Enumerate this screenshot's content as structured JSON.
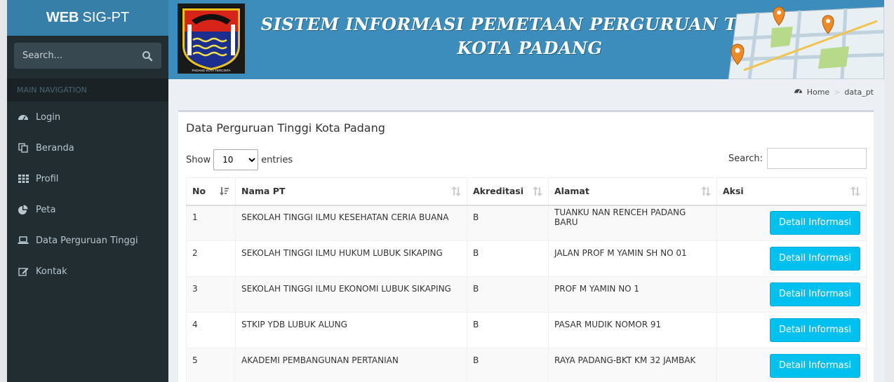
{
  "sidebar": {
    "logo_bold": "WEB",
    "logo_rest": "SIG-PT",
    "search_placeholder": "Search...",
    "nav_header": "MAIN NAVIGATION",
    "items": [
      {
        "label": "Login",
        "icon": "dashboard-icon"
      },
      {
        "label": "Beranda",
        "icon": "files-icon"
      },
      {
        "label": "Profil",
        "icon": "grid-icon"
      },
      {
        "label": "Peta",
        "icon": "pie-chart-icon"
      },
      {
        "label": "Data Perguruan Tinggi",
        "icon": "laptop-icon"
      },
      {
        "label": "Kontak",
        "icon": "edit-icon"
      }
    ]
  },
  "header": {
    "title_line1": "SISTEM INFORMASI PEMETAAN PERGURUAN TINGGI",
    "title_line2": "KOTA PADANG",
    "emblem_text": "PADANG KOTA TERCINTA"
  },
  "breadcrumb": {
    "home": "Home",
    "current": "data_pt"
  },
  "box": {
    "title": "Data Perguruan Tinggi Kota Padang",
    "show_label": "Show",
    "entries_label": "entries",
    "length_value": "10",
    "search_label": "Search:"
  },
  "table": {
    "headers": [
      "No",
      "Nama PT",
      "Akreditasi",
      "Alamat",
      "Aksi"
    ],
    "button_label": "Detail Informasi",
    "rows": [
      {
        "no": "1",
        "nama": "SEKOLAH TINGGI ILMU KESEHATAN CERIA BUANA",
        "akreditasi": "B",
        "alamat": "TUANKU NAN RENCEH PADANG BARU"
      },
      {
        "no": "2",
        "nama": "SEKOLAH TINGGI ILMU HUKUM LUBUK SIKAPING",
        "akreditasi": "B",
        "alamat": "JALAN PROF M YAMIN SH NO 01"
      },
      {
        "no": "3",
        "nama": "SEKOLAH TINGGI ILMU EKONOMI LUBUK SIKAPING",
        "akreditasi": "B",
        "alamat": "PROF M YAMIN NO 1"
      },
      {
        "no": "4",
        "nama": "STKIP YDB LUBUK ALUNG",
        "akreditasi": "B",
        "alamat": "PASAR MUDIK NOMOR 91"
      },
      {
        "no": "5",
        "nama": "AKADEMI PEMBANGUNAN PERTANIAN",
        "akreditasi": "B",
        "alamat": "RAYA PADANG-BKT KM 32 JAMBAK"
      }
    ]
  },
  "colors": {
    "sidebar": "#222d32",
    "header": "#3c8dbc",
    "button": "#00c0ef"
  }
}
